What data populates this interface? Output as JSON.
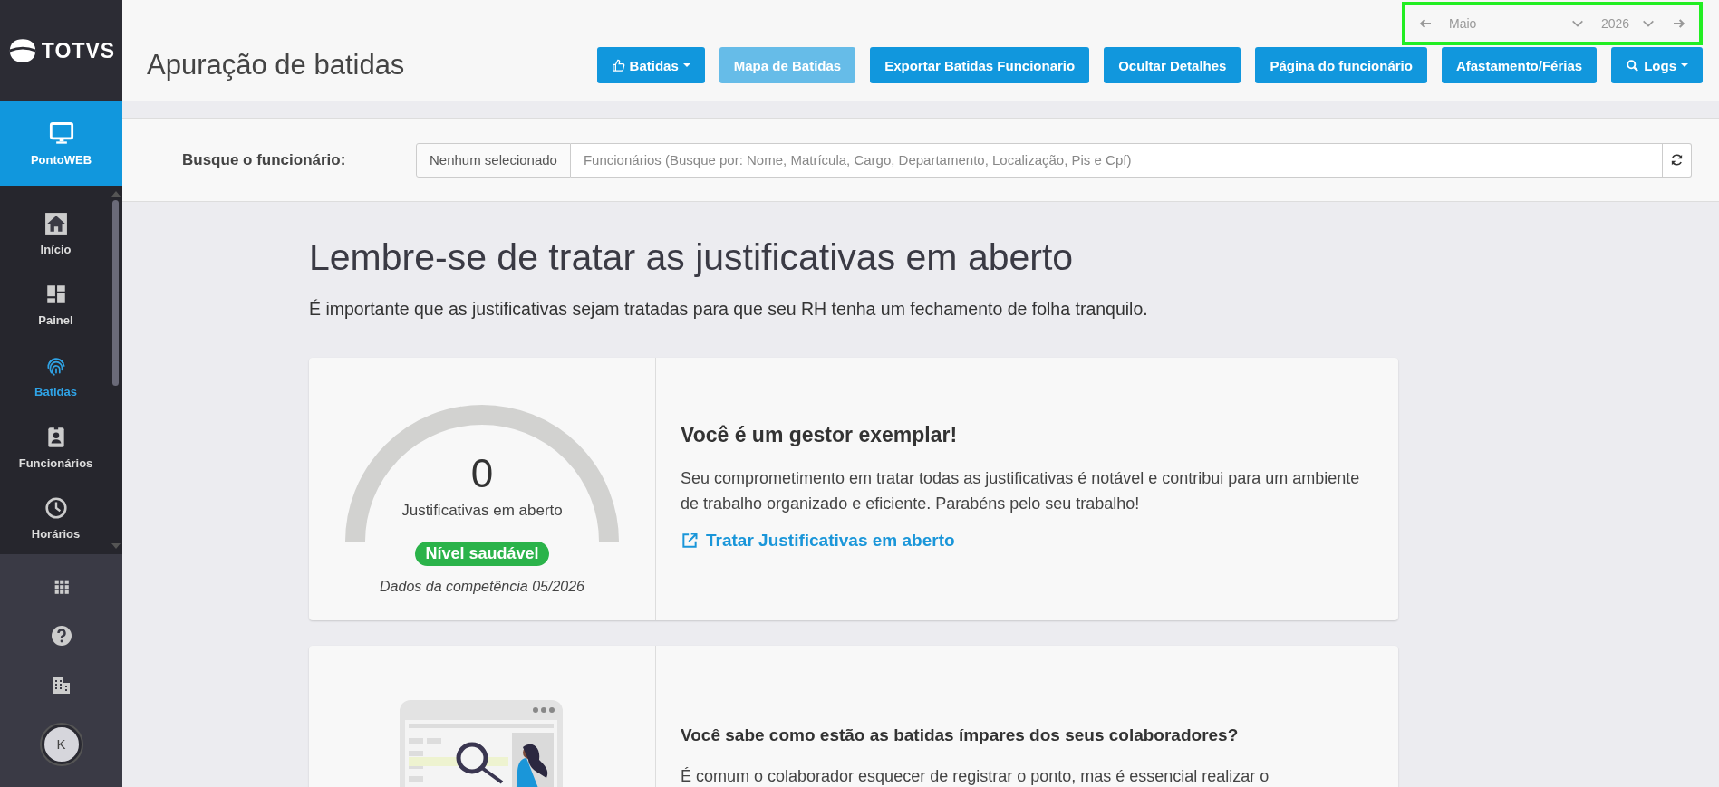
{
  "sidebar": {
    "logo": "TOTVS",
    "module": {
      "label": "PontoWEB"
    },
    "items": [
      {
        "label": "Início",
        "selected": false
      },
      {
        "label": "Painel",
        "selected": false
      },
      {
        "label": "Batidas",
        "selected": true
      },
      {
        "label": "Funcionários",
        "selected": false
      },
      {
        "label": "Horários",
        "selected": false
      }
    ],
    "avatar": "K"
  },
  "header": {
    "title": "Apuração de batidas",
    "period": {
      "month": "Maio",
      "year": "2026",
      "highlighted": true
    },
    "buttons": [
      {
        "label": "Batidas",
        "kind": "dropdown",
        "disabled": false
      },
      {
        "label": "Mapa de Batidas",
        "kind": "plain",
        "disabled": true
      },
      {
        "label": "Exportar Batidas Funcionario",
        "kind": "plain",
        "disabled": false
      },
      {
        "label": "Ocultar Detalhes",
        "kind": "plain",
        "disabled": false
      },
      {
        "label": "Página do funcionário",
        "kind": "plain",
        "disabled": false
      },
      {
        "label": "Afastamento/Férias",
        "kind": "plain",
        "disabled": false
      },
      {
        "label": "Logs",
        "kind": "dropdown",
        "disabled": false
      }
    ]
  },
  "search": {
    "label": "Busque o funcionário:",
    "addon": "Nenhum selecionado",
    "placeholder": "Funcionários (Busque por: Nome, Matrícula, Cargo, Departamento, Localização, Pis e Cpf)"
  },
  "main": {
    "heading": "Lembre-se de tratar as justificativas em aberto",
    "subheading": "É importante que as justificativas sejam tratadas para que seu RH tenha um fechamento de folha tranquilo.",
    "gauge_card": {
      "count": "0",
      "caption": "Justificativas em aberto",
      "badge": "Nível saudável",
      "note": "Dados da competência 05/2026",
      "title": "Você é um gestor exemplar!",
      "text": "Seu comprometimento em tratar todas as justificativas é notável e contribui para um ambiente de trabalho organizado e eficiente. Parabéns pelo seu trabalho!",
      "link": "Tratar Justificativas em aberto"
    },
    "info_card": {
      "title": "Você sabe como estão as batidas ímpares dos seus colaboradores?",
      "text": "É comum o colaborador esquecer de registrar o ponto, mas é essencial realizar o"
    }
  }
}
